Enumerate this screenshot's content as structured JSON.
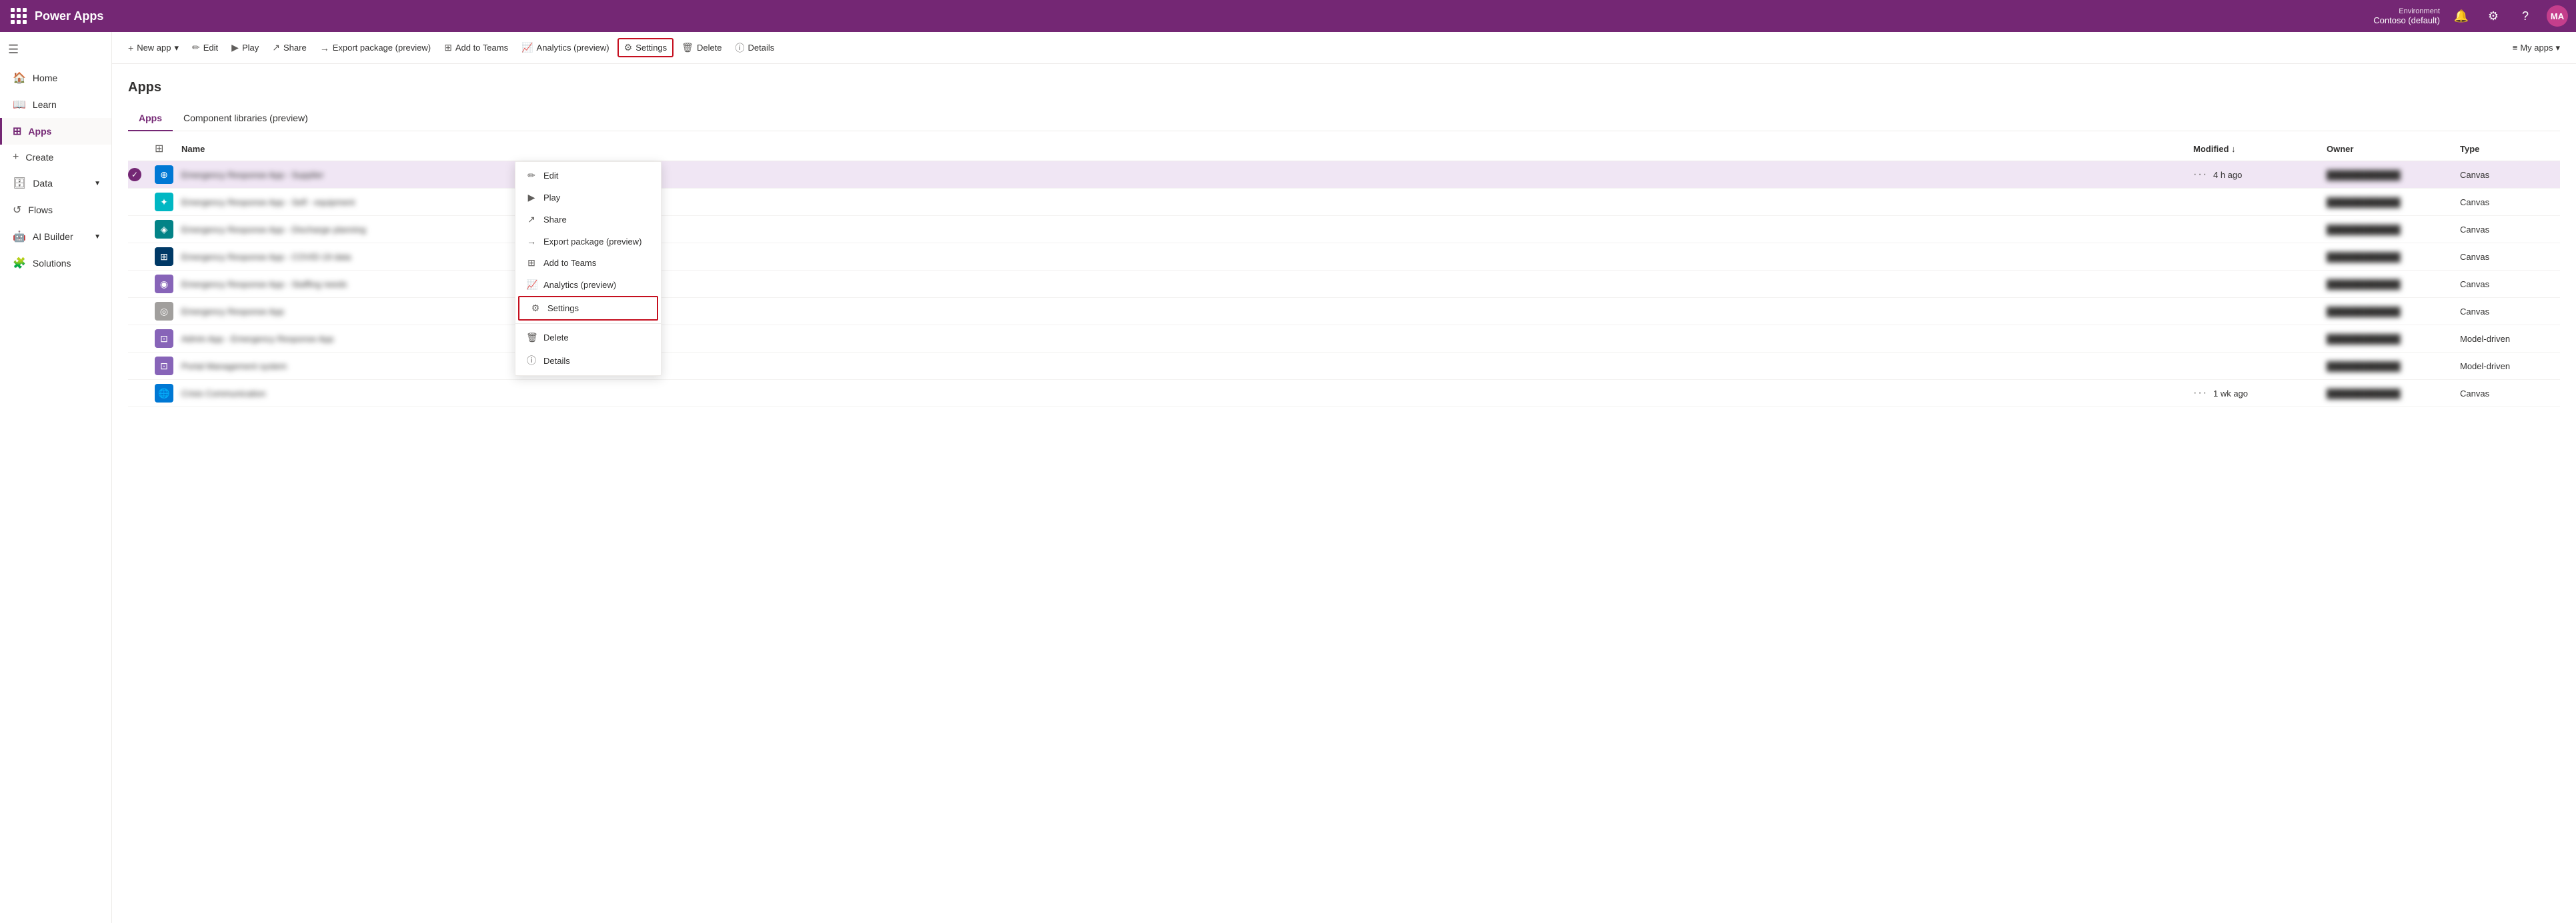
{
  "app_title": "Power Apps",
  "topbar": {
    "environment_label": "Environment",
    "environment_name": "Contoso (default)",
    "avatar_initials": "MA"
  },
  "commandbar": {
    "new_app": "New app",
    "edit": "Edit",
    "play": "Play",
    "share": "Share",
    "export_package": "Export package (preview)",
    "add_to_teams": "Add to Teams",
    "analytics": "Analytics (preview)",
    "settings": "Settings",
    "delete": "Delete",
    "details": "Details",
    "my_apps": "My apps"
  },
  "sidebar": {
    "items": [
      {
        "id": "home",
        "label": "Home",
        "icon": "🏠"
      },
      {
        "id": "learn",
        "label": "Learn",
        "icon": "📖"
      },
      {
        "id": "apps",
        "label": "Apps",
        "icon": "⊞",
        "active": true
      },
      {
        "id": "create",
        "label": "Create",
        "icon": "+"
      },
      {
        "id": "data",
        "label": "Data",
        "icon": "🗄",
        "expandable": true
      },
      {
        "id": "flows",
        "label": "Flows",
        "icon": "↺"
      },
      {
        "id": "ai_builder",
        "label": "AI Builder",
        "icon": "🤖",
        "expandable": true
      },
      {
        "id": "solutions",
        "label": "Solutions",
        "icon": "🧩"
      }
    ]
  },
  "page": {
    "title": "Apps",
    "tabs": [
      {
        "id": "apps",
        "label": "Apps",
        "active": true
      },
      {
        "id": "component_libraries",
        "label": "Component libraries (preview)",
        "active": false
      }
    ]
  },
  "table": {
    "columns": [
      {
        "id": "check",
        "label": ""
      },
      {
        "id": "icon",
        "label": ""
      },
      {
        "id": "name",
        "label": "Name"
      },
      {
        "id": "modified",
        "label": "Modified ↓"
      },
      {
        "id": "owner",
        "label": "Owner"
      },
      {
        "id": "type",
        "label": "Type"
      }
    ],
    "rows": [
      {
        "id": 1,
        "selected": true,
        "icon_class": "app-icon-blue",
        "icon_char": "⊕",
        "name": "Emergency Response App - Supplier",
        "modified": "4 h ago",
        "has_dots": true,
        "owner": "████████████",
        "type": "Canvas"
      },
      {
        "id": 2,
        "selected": false,
        "icon_class": "app-icon-cyan",
        "icon_char": "✦",
        "name": "Emergency Response App - Self - equipment",
        "modified": "",
        "has_dots": false,
        "owner": "████████████",
        "type": "Canvas"
      },
      {
        "id": 3,
        "selected": false,
        "icon_class": "app-icon-teal",
        "icon_char": "◈",
        "name": "Emergency Response App - Discharge planning",
        "modified": "",
        "has_dots": false,
        "owner": "████████████",
        "type": "Canvas"
      },
      {
        "id": 4,
        "selected": false,
        "icon_class": "app-icon-darkblue",
        "icon_char": "⊞",
        "name": "Emergency Response App - COVID-19 data",
        "modified": "",
        "has_dots": false,
        "owner": "████████████",
        "type": "Canvas"
      },
      {
        "id": 5,
        "selected": false,
        "icon_class": "app-icon-purple",
        "icon_char": "◉",
        "name": "Emergency Response App - Staffing needs",
        "modified": "",
        "has_dots": false,
        "owner": "████████████",
        "type": "Canvas"
      },
      {
        "id": 6,
        "selected": false,
        "icon_class": "app-icon-gray",
        "icon_char": "◎",
        "name": "Emergency Response App",
        "modified": "",
        "has_dots": false,
        "owner": "████████████",
        "type": "Canvas"
      },
      {
        "id": 7,
        "selected": false,
        "icon_class": "app-icon-purple",
        "icon_char": "⊡",
        "name": "Admin App - Emergency Response App",
        "modified": "",
        "has_dots": false,
        "owner": "████████████",
        "type": "Model-driven"
      },
      {
        "id": 8,
        "selected": false,
        "icon_class": "app-icon-purple",
        "icon_char": "⊡",
        "name": "Portal Management system",
        "modified": "",
        "has_dots": false,
        "owner": "████████████",
        "type": "Model-driven"
      },
      {
        "id": 9,
        "selected": false,
        "icon_class": "app-icon-globe",
        "icon_char": "🌐",
        "name": "Crisis Communication",
        "modified": "1 wk ago",
        "has_dots": true,
        "owner": "████████████",
        "type": "Canvas"
      }
    ]
  },
  "context_menu": {
    "items": [
      {
        "id": "edit",
        "label": "Edit",
        "icon": "✏"
      },
      {
        "id": "play",
        "label": "Play",
        "icon": "▶"
      },
      {
        "id": "share",
        "label": "Share",
        "icon": "↗"
      },
      {
        "id": "export",
        "label": "Export package (preview)",
        "icon": "→"
      },
      {
        "id": "add_to_teams",
        "label": "Add to Teams",
        "icon": "⊞"
      },
      {
        "id": "analytics",
        "label": "Analytics (preview)",
        "icon": "📈"
      },
      {
        "id": "settings",
        "label": "Settings",
        "icon": "⚙",
        "highlighted": true
      },
      {
        "id": "delete",
        "label": "Delete",
        "icon": "🗑"
      },
      {
        "id": "details",
        "label": "Details",
        "icon": "ⓘ"
      }
    ]
  }
}
